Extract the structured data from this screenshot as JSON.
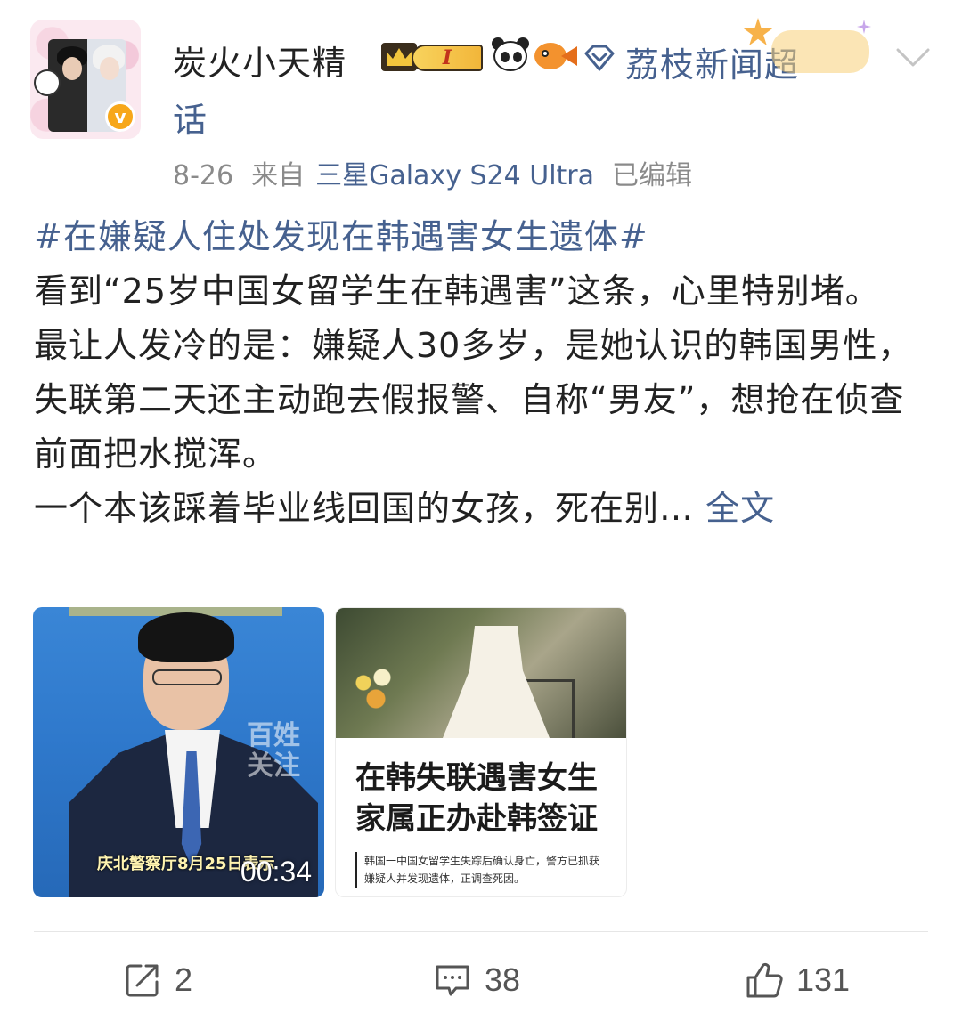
{
  "post": {
    "author": {
      "username": "炭火小天精",
      "level": "I",
      "verified_mark": "v"
    },
    "supertopic": {
      "name_part1": "荔枝新闻超",
      "name_part2": "话"
    },
    "meta": {
      "date": "8-26",
      "source_prefix": "来自",
      "device": "三星Galaxy S24 Ultra",
      "edited": "已编辑"
    },
    "hashtag": "#在嫌疑人住处发现在韩遇害女生遗体#",
    "paragraphs": [
      "看到“25岁中国女留学生在韩遇害”这条，心里特别堵。",
      "最让人发冷的是：嫌疑人30多岁，是她认识的韩国男性，失联第二天还主动跑去假报警、自称“男友”，想抢在侦查前面把水搅浑。"
    ],
    "truncated_line": "一个本该踩着毕业线回国的女孩，死在别…",
    "fulltext_link": "全文"
  },
  "media": {
    "video": {
      "watermark": "百姓关注",
      "caption": "庆北警察厅8月25日表示",
      "duration": "00:34"
    },
    "article": {
      "headline_line1": "在韩失联遇害女生",
      "headline_line2": "家属正办赴韩签证",
      "summary_line1": "韩国一中国女留学生失踪后确认身亡，警方已抓获",
      "summary_line2": "嫌疑人并发现遗体，正调查死因。"
    }
  },
  "actions": {
    "share_count": "2",
    "comment_count": "38",
    "like_count": "131"
  },
  "colors": {
    "link": "#46618f",
    "meta": "#8a8a8a",
    "text": "#222222",
    "verified": "#f7a71a"
  },
  "icons": {
    "share": "share-icon",
    "comment": "comment-icon",
    "like": "thumbs-up-icon",
    "more": "chevron-down-icon",
    "supertopic": "supertopic-diamond-icon"
  }
}
